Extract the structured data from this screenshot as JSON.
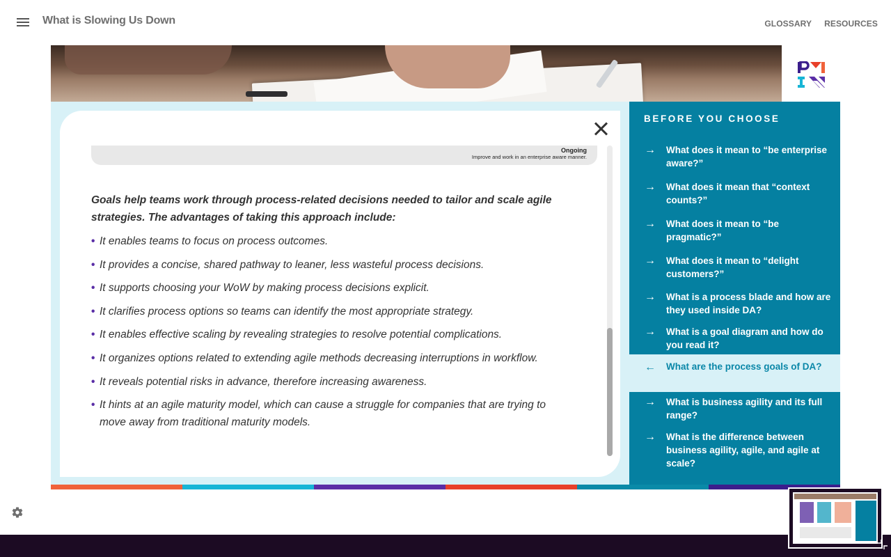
{
  "header": {
    "title": "What is Slowing Us Down",
    "nav": [
      "GLOSSARY",
      "RESOURCES"
    ]
  },
  "goal_strip": {
    "title": "Ongoing",
    "subtitle": "Improve and work in an enterprise aware manner."
  },
  "content": {
    "intro": "Goals help teams work through process-related decisions needed to tailor and scale agile strategies. The advantages of taking this approach include:",
    "bullets": [
      "It enables teams to focus on process outcomes.",
      "It provides a concise, shared pathway to leaner, less wasteful process decisions.",
      "It supports choosing your WoW by making process decisions explicit.",
      "It clarifies process options so teams can identify the most appropriate strategy.",
      "It enables effective scaling by revealing strategies to resolve potential complications.",
      "It organizes options related to extending agile methods decreasing interruptions in workflow.",
      "It reveals potential risks in advance, therefore increasing awareness.",
      "It hints at an agile maturity model, which can cause a struggle for companies that are trying to move away from traditional maturity models."
    ]
  },
  "sidebar": {
    "heading": "BEFORE YOU CHOOSE",
    "items": [
      {
        "label": "What does it mean to “be enterprise aware?”",
        "arrow": "→"
      },
      {
        "label": "What does it mean that “context counts?”",
        "arrow": "→"
      },
      {
        "label": "What does it mean to “be pragmatic?”",
        "arrow": "→"
      },
      {
        "label": "What does it mean to “delight customers?”",
        "arrow": "→"
      },
      {
        "label": "What is a process blade and how are they used inside DA?",
        "arrow": "→"
      },
      {
        "label": "What is a goal diagram and how do you read it?",
        "arrow": "→"
      },
      {
        "label": "What are the process goals of DA?",
        "arrow": "←",
        "active": true
      },
      {
        "label": "What is business agility and its full range?",
        "arrow": "→"
      },
      {
        "label": "What is the difference between business agility, agile, and agile  at scale?",
        "arrow": "→"
      }
    ]
  },
  "colors": {
    "sidebar": "#0580a1",
    "slide_bg": "#d8f1f7",
    "footer": "#1c0b23",
    "colorbar": [
      "#f0623a",
      "#17b5d6",
      "#5a2ea6",
      "#e8402a",
      "#0a8aa8",
      "#3b1e8c"
    ]
  },
  "icons": {
    "menu": "hamburger-icon",
    "close": "close-icon",
    "settings": "gear-icon",
    "resize": "resize-handle-icon"
  }
}
